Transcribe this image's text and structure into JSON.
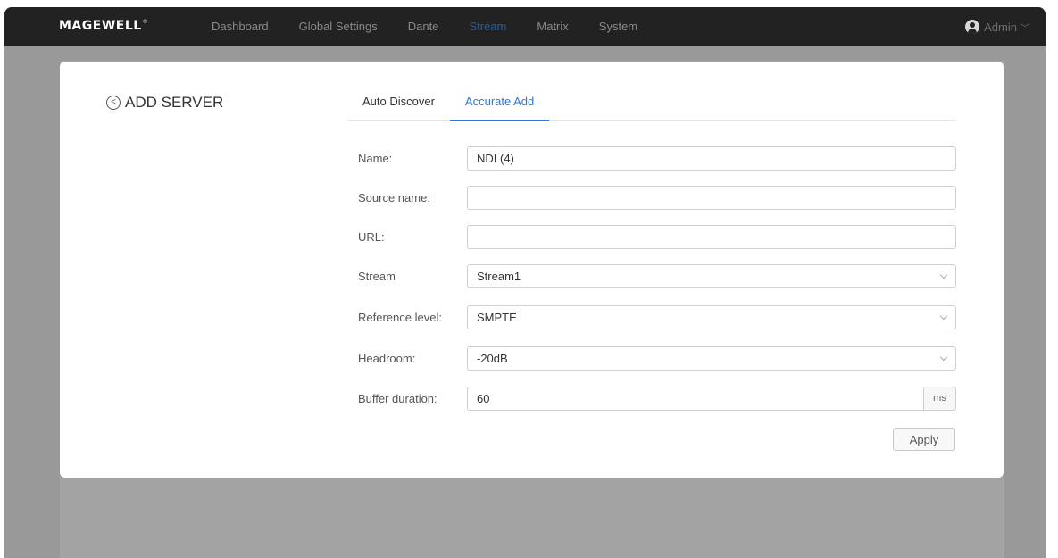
{
  "brand": {
    "logo": "MAGEWELL",
    "mark": "®"
  },
  "nav": {
    "items": [
      {
        "label": "Dashboard",
        "active": false
      },
      {
        "label": "Global Settings",
        "active": false
      },
      {
        "label": "Dante",
        "active": false
      },
      {
        "label": "Stream",
        "active": true
      },
      {
        "label": "Matrix",
        "active": false
      },
      {
        "label": "System",
        "active": false
      }
    ],
    "user": "Admin"
  },
  "page": {
    "title": "ADD SERVER",
    "tabs": [
      {
        "label": "Auto Discover",
        "active": false
      },
      {
        "label": "Accurate Add",
        "active": true
      }
    ]
  },
  "form": {
    "name": {
      "label": "Name:",
      "value": "NDI (4)"
    },
    "source_name": {
      "label": "Source name:",
      "value": ""
    },
    "url": {
      "label": "URL:",
      "value": ""
    },
    "stream": {
      "label": "Stream",
      "value": "Stream1"
    },
    "reference_level": {
      "label": "Reference level:",
      "value": "SMPTE"
    },
    "headroom": {
      "label": "Headroom:",
      "value": "-20dB"
    },
    "buffer_duration": {
      "label": "Buffer duration:",
      "value": "60",
      "unit": "ms"
    },
    "apply_label": "Apply"
  },
  "colors": {
    "accent": "#2a79d2",
    "nav_active": "#1f5fa9",
    "topbar": "#222222"
  }
}
